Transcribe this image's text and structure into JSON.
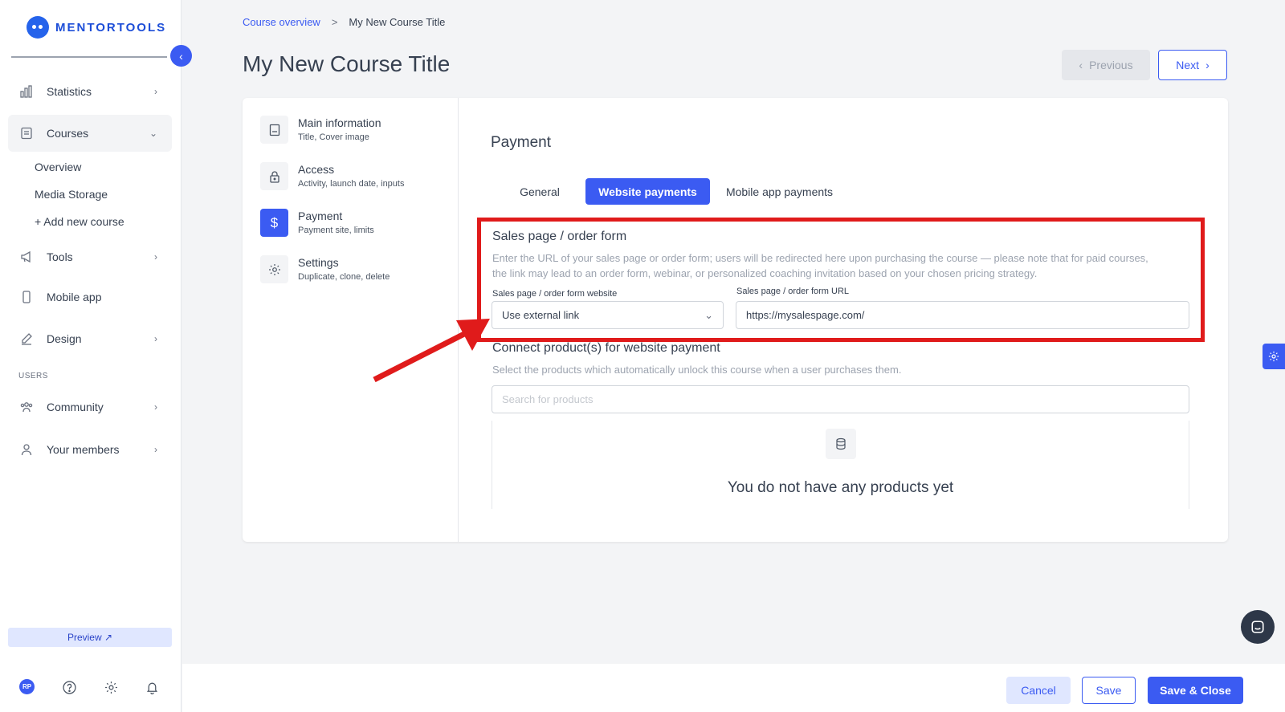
{
  "brand": {
    "name": "MENTORTOOLS"
  },
  "sidebar": {
    "items": [
      {
        "label": "Statistics",
        "icon": "bar-chart-icon"
      },
      {
        "label": "Courses",
        "icon": "book-icon"
      },
      {
        "label": "Tools",
        "icon": "megaphone-icon"
      },
      {
        "label": "Mobile app",
        "icon": "phone-icon"
      },
      {
        "label": "Design",
        "icon": "pencil-icon"
      },
      {
        "label": "Community",
        "icon": "people-icon"
      },
      {
        "label": "Your members",
        "icon": "user-icon"
      }
    ],
    "courses_sub": [
      "Overview",
      "Media Storage",
      "+ Add new course"
    ],
    "users_section": "USERS",
    "preview_label": "Preview ↗",
    "avatar_initials": "RP"
  },
  "breadcrumb": {
    "parent": "Course overview",
    "separator": ">",
    "current": "My New Course Title"
  },
  "page_title": "My New Course Title",
  "nav_buttons": {
    "previous": "Previous",
    "next": "Next"
  },
  "steps": [
    {
      "title": "Main information",
      "sub": "Title, Cover image"
    },
    {
      "title": "Access",
      "sub": "Activity, launch date, inputs"
    },
    {
      "title": "Payment",
      "sub": "Payment site, limits"
    },
    {
      "title": "Settings",
      "sub": "Duplicate, clone, delete"
    }
  ],
  "payment": {
    "title": "Payment",
    "tabs": [
      "General",
      "Website payments",
      "Mobile app payments"
    ],
    "sales": {
      "title": "Sales page / order form",
      "desc_line1": "Enter the URL of your sales page or order form; users will be redirected here upon purchasing the course — please note that for paid courses,",
      "desc_line2": "the link may lead to an order form, webinar, or personalized coaching invitation based on your chosen pricing strategy.",
      "website_label": "Sales page / order form website",
      "website_value": "Use external link",
      "url_label": "Sales page / order form URL",
      "url_value": "https://mysalespage.com/"
    },
    "connect": {
      "title": "Connect product(s) for website payment",
      "desc": "Select the products which automatically unlock this course when a user purchases them.",
      "search_placeholder": "Search for products",
      "empty_text": "You do not have any products yet"
    }
  },
  "footer": {
    "cancel": "Cancel",
    "save": "Save",
    "save_close": "Save & Close"
  },
  "colors": {
    "accent": "#3b5bf2",
    "highlight": "#e01b1b"
  }
}
